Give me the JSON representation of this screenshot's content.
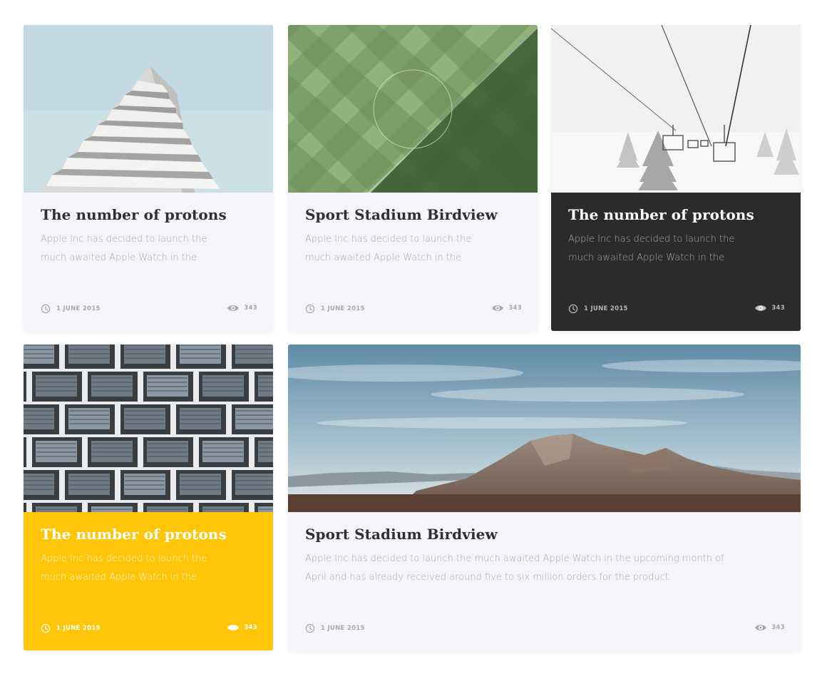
{
  "colors": {
    "card_light": "#f4f5f8",
    "card_dark": "#2b2b2b",
    "card_yellow": "#ffc609",
    "meta_text": "#a7a9ae"
  },
  "cards": [
    {
      "variant": "light",
      "image": "white-building-pyramid-photo",
      "title": "The number of protons",
      "excerpt": "Apple Inc has decided to launch the much awaited Apple Watch in the",
      "date": "1 JUNE 2015",
      "views": "343",
      "date_icon": "clock-icon",
      "views_icon": "eye-icon"
    },
    {
      "variant": "light",
      "image": "stadium-field-aerial-photo",
      "title": "Sport Stadium Birdview",
      "excerpt": "Apple Inc has decided to launch the much awaited Apple Watch in the",
      "date": "1 JUNE 2015",
      "views": "343",
      "date_icon": "clock-icon",
      "views_icon": "eye-icon"
    },
    {
      "variant": "dark",
      "image": "ski-lift-in-fog-photo",
      "title": "The number of protons",
      "excerpt": "Apple Inc has decided to launch the much awaited Apple Watch in the",
      "date": "1 JUNE 2015",
      "views": "343",
      "date_icon": "clock-icon",
      "views_icon": "eye-icon"
    },
    {
      "variant": "yellow",
      "image": "building-facade-windows-photo",
      "title": "The number of protons",
      "excerpt": "Apple Inc has decided to launch the much awaited Apple Watch in the",
      "date": "1 JUNE 2015",
      "views": "343",
      "date_icon": "clock-icon",
      "views_icon": "eye-icon"
    },
    {
      "variant": "light",
      "image": "mountain-landscape-photo",
      "title": "Sport Stadium Birdview",
      "excerpt": "Apple Inc has decided to launch the much awaited Apple Watch in the upcoming month of April and has already received around five to six million orders for the product.",
      "date": "1 JUNE 2015",
      "views": "343",
      "date_icon": "clock-icon",
      "views_icon": "eye-icon"
    }
  ]
}
